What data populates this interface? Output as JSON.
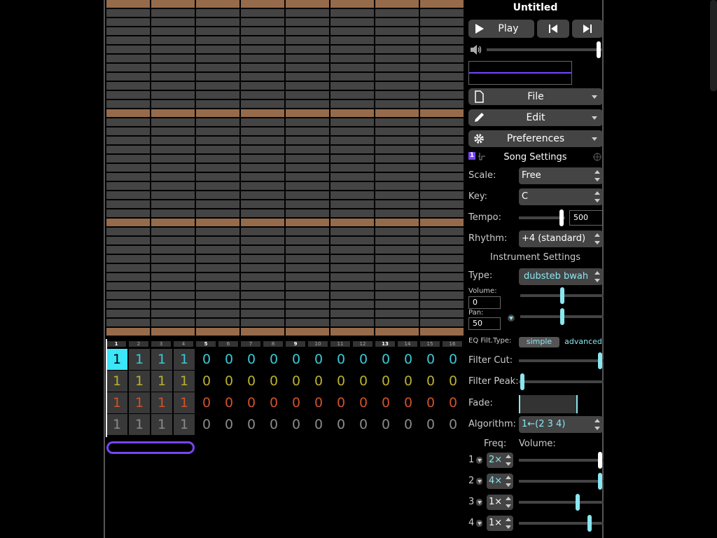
{
  "song": {
    "title": "Untitled"
  },
  "transport": {
    "play_label": "Play",
    "play_icon": "play-icon",
    "prev_icon": "skip-back-icon",
    "next_icon": "skip-forward-icon",
    "volume_fraction": 0.98
  },
  "menus": [
    {
      "label": "File",
      "icon": "file-icon"
    },
    {
      "label": "Edit",
      "icon": "pencil-icon"
    },
    {
      "label": "Preferences",
      "icon": "gear-icon"
    }
  ],
  "song_settings": {
    "heading": "Song Settings",
    "scale_label": "Scale:",
    "scale_value": "Free",
    "key_label": "Key:",
    "key_value": "C",
    "tempo_label": "Tempo:",
    "tempo_value": "500",
    "tempo_fraction": 0.97,
    "rhythm_label": "Rhythm:",
    "rhythm_value": "+4 (standard)"
  },
  "instrument_settings": {
    "heading": "Instrument Settings",
    "type_label": "Type:",
    "type_value": "dubsteb bwah",
    "volume_label": "Volume:",
    "volume_value": "0",
    "volume_fraction": 0.5,
    "pan_label": "Pan:",
    "pan_value": "50",
    "pan_fraction": 0.5,
    "eq_label": "EQ Filt.Type:",
    "eq_simple": "simple",
    "eq_advanced": "advanced",
    "filter_cut_label": "Filter Cut:",
    "filter_cut_fraction": 0.98,
    "filter_peak_label": "Filter Peak:",
    "filter_peak_fraction": 0.02,
    "fade_label": "Fade:",
    "algorithm_label": "Algorithm:",
    "algorithm_value": "1←(2 3 4)",
    "freq_heading": "Freq:",
    "volume_heading": "Volume:",
    "operators": [
      {
        "num": "1",
        "freq": "2×",
        "vol_fraction": 0.98
      },
      {
        "num": "2",
        "freq": "4×",
        "vol_fraction": 0.98
      },
      {
        "num": "3",
        "freq": "1×",
        "vol_fraction": 0.7
      },
      {
        "num": "4",
        "freq": "1×",
        "vol_fraction": 0.85
      }
    ]
  },
  "bar_numbers": [
    "1",
    "2",
    "3",
    "4",
    "5",
    "6",
    "7",
    "8",
    "9",
    "10",
    "11",
    "12",
    "13",
    "14",
    "15",
    "16"
  ],
  "highlighted_bars": [
    "1",
    "5",
    "9",
    "13"
  ],
  "tracks": [
    {
      "color": "#3ac8d6",
      "values": [
        "1",
        "1",
        "1",
        "1",
        "0",
        "0",
        "0",
        "0",
        "0",
        "0",
        "0",
        "0",
        "0",
        "0",
        "0",
        "0"
      ]
    },
    {
      "color": "#b8b030",
      "values": [
        "1",
        "1",
        "1",
        "1",
        "0",
        "0",
        "0",
        "0",
        "0",
        "0",
        "0",
        "0",
        "0",
        "0",
        "0",
        "0"
      ]
    },
    {
      "color": "#d0522a",
      "values": [
        "1",
        "1",
        "1",
        "1",
        "0",
        "0",
        "0",
        "0",
        "0",
        "0",
        "0",
        "0",
        "0",
        "0",
        "0",
        "0"
      ]
    },
    {
      "color": "#8a8a8a",
      "values": [
        "1",
        "1",
        "1",
        "1",
        "0",
        "0",
        "0",
        "0",
        "0",
        "0",
        "0",
        "0",
        "0",
        "0",
        "0",
        "0"
      ]
    }
  ],
  "selected_cell": {
    "track": 0,
    "bar": 0
  }
}
